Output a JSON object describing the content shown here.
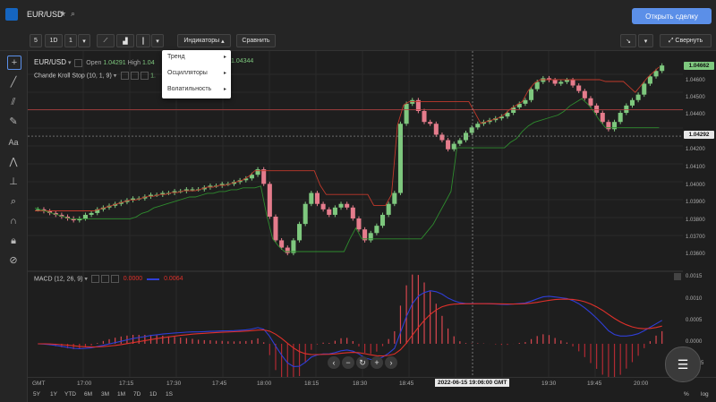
{
  "header": {
    "symbol": "EUR/USD",
    "open_trade_button": "Открыть сделку"
  },
  "toolbar": {
    "interval_minutes": "5",
    "interval_day": "1D",
    "interval_count": "1",
    "indicators_button": "Индикаторы",
    "compare_button": "Сравнить",
    "collapse_button": "Свернуть"
  },
  "indicators_menu": {
    "items": [
      "Тренд",
      "Осцилляторы",
      "Волатильность"
    ]
  },
  "legend": {
    "symbol": "EUR/USD",
    "open_label": "Open",
    "open_value": "1.04291",
    "high_label": "High",
    "high_value": "1.04",
    "close_partial": "1.04344",
    "indicator_name": "Chande Kroll Stop (10, 1, 9)",
    "indicator_value_partial": "1."
  },
  "macd_legend": {
    "name": "MACD (12, 26, 9)",
    "value1": "0.0000",
    "value2": "0.0064"
  },
  "price_axis": {
    "labels": [
      "1.04600",
      "1.04500",
      "1.04400",
      "1.04200",
      "1.04100",
      "1.04000",
      "1.03900",
      "1.03800",
      "1.03700",
      "1.03600"
    ],
    "current_price": "1.04662",
    "crosshair_price": "1.04292"
  },
  "macd_axis": {
    "labels": [
      "0.0015",
      "0.0010",
      "0.0005",
      "0.0000",
      "-0.0005"
    ]
  },
  "time_axis": {
    "tz": "GMT",
    "labels": [
      "17:00",
      "17:15",
      "17:30",
      "17:45",
      "18:00",
      "18:15",
      "18:30",
      "18:45",
      "19:30",
      "19:45",
      "20:00"
    ],
    "crosshair_time": "2022-06-15 19:06:00 GMT"
  },
  "ranges": [
    "5Y",
    "1Y",
    "YTD",
    "6M",
    "3M",
    "1M",
    "7D",
    "1D",
    "1S"
  ],
  "bottom_right": {
    "percent": "%",
    "log": "log"
  },
  "colors": {
    "bull": "#7ec87e",
    "bear": "#e57c8c",
    "stop_red": "#c0392b",
    "stop_green": "#2e8b2e",
    "macd_blue": "#2f3ed6",
    "signal_red": "#e0302a",
    "accent": "#5b8fe8"
  },
  "chart_data": {
    "type": "candlestick",
    "price_range": [
      1.0355,
      1.0472
    ],
    "closes": [
      1.0389,
      1.0388,
      1.0387,
      1.0386,
      1.0385,
      1.0384,
      1.0383,
      1.0384,
      1.0386,
      1.0387,
      1.0389,
      1.039,
      1.0391,
      1.0392,
      1.0393,
      1.0394,
      1.0395,
      1.0395,
      1.0396,
      1.0397,
      1.0397,
      1.0398,
      1.0398,
      1.0399,
      1.0399,
      1.04,
      1.04,
      1.04,
      1.0401,
      1.0402,
      1.0402,
      1.0403,
      1.0403,
      1.0404,
      1.0405,
      1.0406,
      1.0408,
      1.0411,
      1.0403,
      1.0385,
      1.0372,
      1.0368,
      1.0365,
      1.0372,
      1.0381,
      1.0392,
      1.0398,
      1.0392,
      1.0389,
      1.0386,
      1.039,
      1.0392,
      1.039,
      1.0384,
      1.0378,
      1.0372,
      1.0376,
      1.038,
      1.0386,
      1.0392,
      1.0398,
      1.0436,
      1.0447,
      1.0449,
      1.0443,
      1.0437,
      1.0436,
      1.043,
      1.0427,
      1.0422,
      1.0425,
      1.0427,
      1.0431,
      1.0434,
      1.0436,
      1.0437,
      1.0438,
      1.0439,
      1.044,
      1.0442,
      1.0445,
      1.0447,
      1.0449,
      1.0455,
      1.0459,
      1.0461,
      1.046,
      1.0458,
      1.0459,
      1.046,
      1.0457,
      1.0454,
      1.045,
      1.0446,
      1.0442,
      1.0437,
      1.0433,
      1.0437,
      1.0442,
      1.0446,
      1.0449,
      1.0452,
      1.0458,
      1.0462,
      1.0465,
      1.0468
    ]
  }
}
